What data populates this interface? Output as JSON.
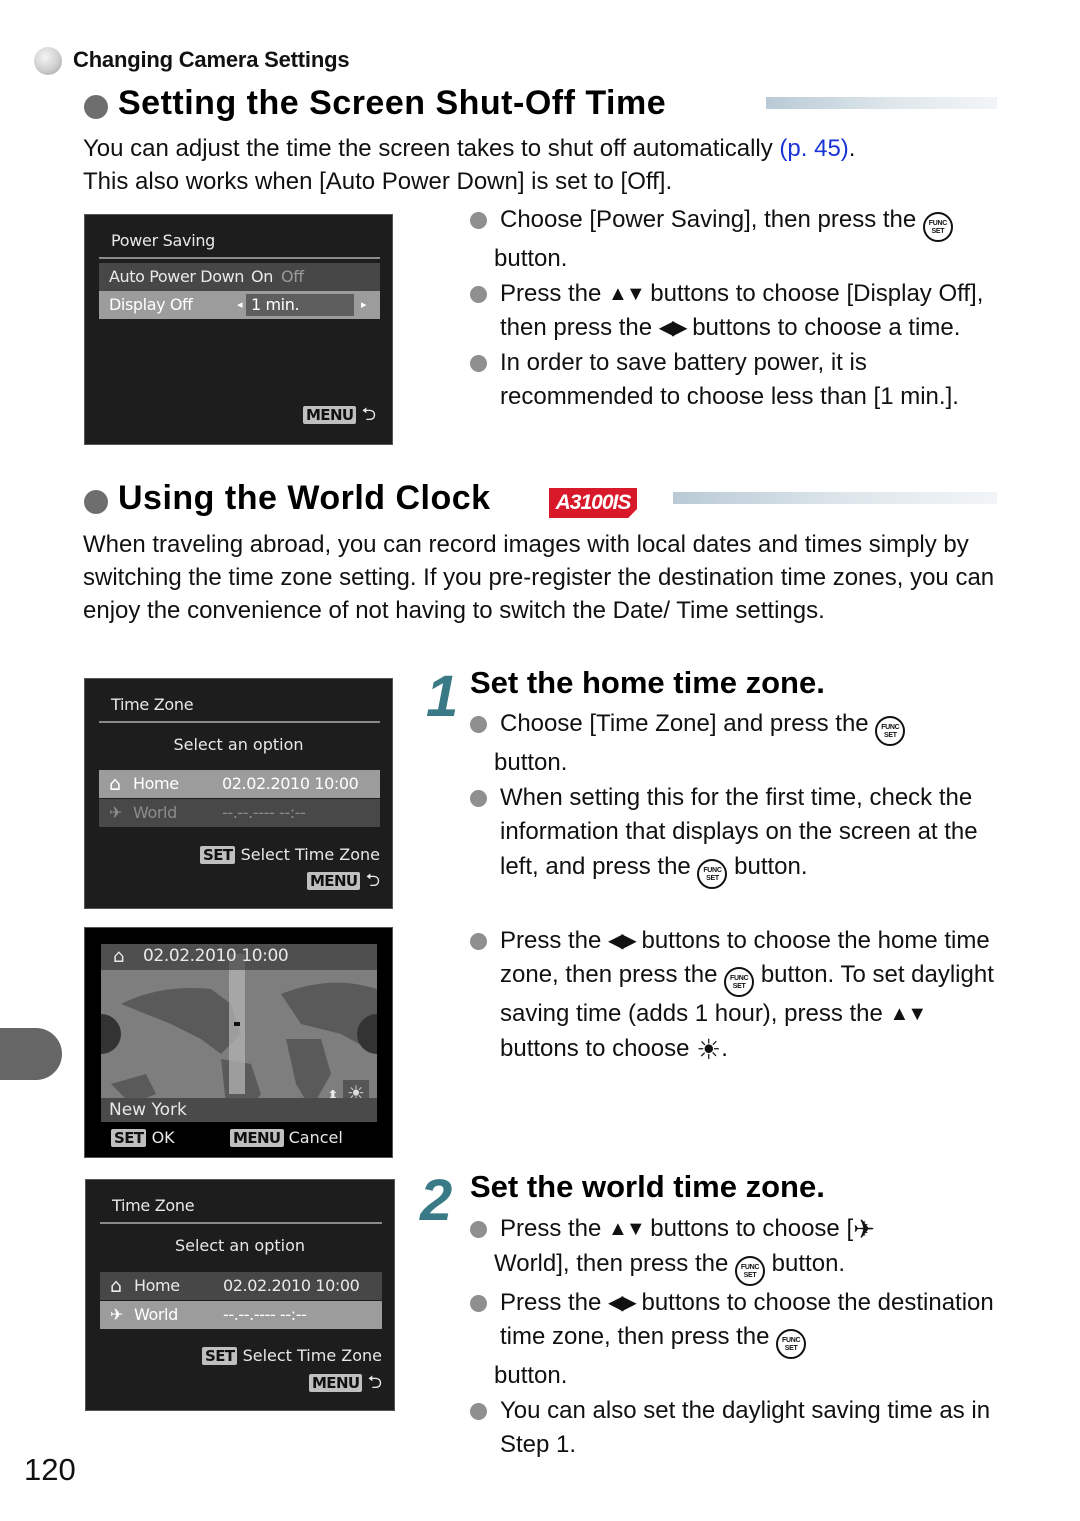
{
  "breadcrumb": "Changing Camera Settings",
  "section1": {
    "title": "Setting the Screen Shut-Off Time",
    "intro_part1": "You can adjust the time the screen takes to shut off automatically ",
    "intro_link": "(p. 45)",
    "intro_part2": ".",
    "intro_line2": "This also works when [Auto Power Down] is set to [Off].",
    "screen": {
      "title": "Power Saving",
      "rows": [
        {
          "label": "Auto Power Down",
          "value_on": "On",
          "value_off": "Off"
        },
        {
          "label": "Display Off",
          "value": "1 min."
        }
      ],
      "menu_key": "MENU",
      "back_icon": "return-arrow-icon"
    },
    "bullets": [
      {
        "text_a": "Choose [Power Saving], then press the ",
        "icon": "func-set-button-icon",
        "text_b": " button."
      },
      {
        "text_a": "Press the ",
        "icon": "up-down-arrows-icon",
        "text_b": " buttons to choose [Display Off], then press the ",
        "icon2": "left-right-arrows-icon",
        "text_c": " buttons to choose a time."
      },
      {
        "text_a": "In order to save battery power, it is recommended to choose less than [1 min.]."
      }
    ]
  },
  "section2": {
    "title": "Using the World Clock",
    "model_badge": "A3100IS",
    "intro": "When traveling abroad, you can record images with local dates and times simply by switching the time zone setting. If you pre-register the destination time zones, you can enjoy the convenience of not having to switch the Date/ Time settings.",
    "screen_home": {
      "title": "Time Zone",
      "subtitle": "Select an option",
      "rows": [
        {
          "icon": "home-icon",
          "label": "Home",
          "value": "02.02.2010 10:00"
        },
        {
          "icon": "airplane-icon",
          "label": "World",
          "value": "--.--.---- --:--"
        }
      ],
      "set_key": "SET",
      "set_label": "Select Time Zone",
      "menu_key": "MENU"
    },
    "screen_map": {
      "datetime": "02.02.2010 10:00",
      "city": "New York",
      "set_key": "SET",
      "ok_label": "OK",
      "menu_key": "MENU",
      "cancel_label": "Cancel"
    },
    "screen_world": {
      "title": "Time Zone",
      "subtitle": "Select an option",
      "rows": [
        {
          "icon": "home-icon",
          "label": "Home",
          "value": "02.02.2010 10:00"
        },
        {
          "icon": "airplane-icon",
          "label": "World",
          "value": "--.--.---- --:--"
        }
      ],
      "set_key": "SET",
      "set_label": "Select Time Zone",
      "menu_key": "MENU"
    },
    "step1": {
      "number": "1",
      "title": "Set the home time zone.",
      "b1a": "Choose [Time Zone] and press the ",
      "b1b": " button.",
      "b2a": "When setting this for the first time, check the information that displays on the screen at the left, and press the ",
      "b2b": " button.",
      "b3a": "Press the ",
      "b3b": " buttons to choose the home time zone, then press the ",
      "b3c": " button. To set daylight saving time (adds 1 hour), press the ",
      "b3d": " buttons to choose ",
      "b3e": "."
    },
    "step2": {
      "number": "2",
      "title": "Set the world time zone.",
      "b1a": "Press the ",
      "b1b": " buttons to choose [",
      "b1c": " World], then press the ",
      "b1d": " button.",
      "b2a": "Press the ",
      "b2b": " buttons to choose the destination time zone, then press the ",
      "b2c": " button.",
      "b3": "You can also set the daylight saving time as in Step 1."
    }
  },
  "glyphs": {
    "func_top": "FUNC",
    "func_bot": "SET",
    "updown": "▲▼",
    "leftright": "◀▶",
    "sun": "☀",
    "plane": "✈",
    "home": "⌂",
    "ret": "⮌",
    "tri_left": "◂",
    "tri_right": "▸"
  },
  "page_number": "120"
}
